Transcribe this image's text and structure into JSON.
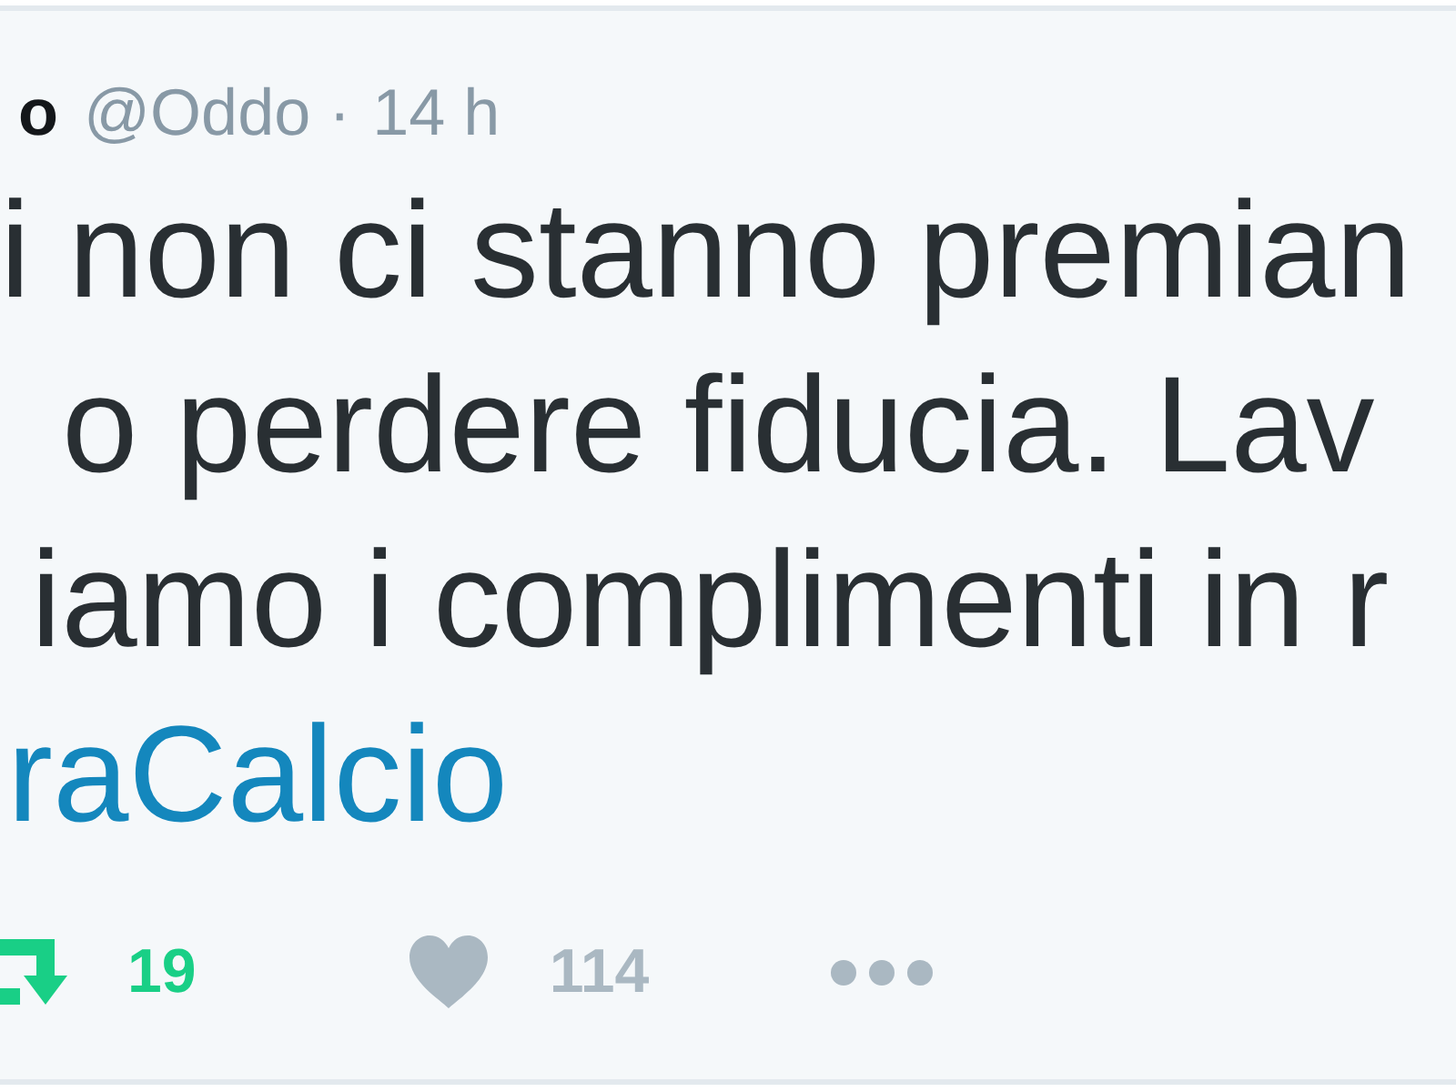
{
  "tweet": {
    "author": {
      "name": "o",
      "handle": "@Oddo",
      "separator": "·",
      "time": "14 h"
    },
    "lines": [
      {
        "kind": "text",
        "text": "i non ci stanno premian"
      },
      {
        "kind": "text",
        "text": "o perdere fiducia. Lav"
      },
      {
        "kind": "text",
        "text": "iamo i complimenti in r"
      },
      {
        "kind": "hashtag",
        "text": "raCalcio"
      }
    ],
    "actions": [
      {
        "kind": "retweet",
        "count": "19",
        "on": true
      },
      {
        "kind": "like",
        "count": "114",
        "on": false
      },
      {
        "kind": "more"
      }
    ]
  }
}
